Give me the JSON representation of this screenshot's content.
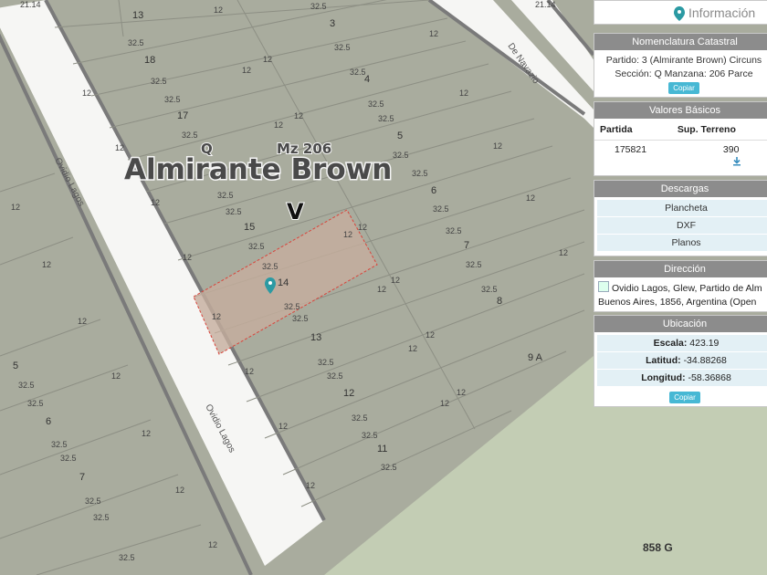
{
  "map": {
    "district_title": "Almirante Brown",
    "manzana_label": "Mz 206",
    "section_label": "Q",
    "circ_label": "V",
    "area_label": "858 G",
    "streets": [
      "Ovidio Lagos",
      "Ovidio Lagos",
      "De Navazio"
    ],
    "lot_numbers": [
      "3",
      "4",
      "5",
      "6",
      "7",
      "8",
      "9 A",
      "18",
      "17",
      "15",
      "14",
      "13",
      "12",
      "11",
      "5",
      "6",
      "7",
      "13"
    ],
    "dimensions": [
      "32.5",
      "12",
      "21.14"
    ],
    "selected_lot": "14"
  },
  "panel": {
    "info_title": "Información",
    "nomenclatura": {
      "header": "Nomenclatura Catastral",
      "line1": "Partido: 3 (Almirante Brown) Circuns",
      "line2": "Sección: Q Manzana: 206 Parce",
      "button": "Copiar"
    },
    "valores": {
      "header": "Valores Básicos",
      "col1": "Partida",
      "col2": "Sup. Terreno",
      "partida": "175821",
      "superficie": "390"
    },
    "descargas": {
      "header": "Descargas",
      "items": [
        "Plancheta",
        "DXF",
        "Planos"
      ]
    },
    "direccion": {
      "header": "Dirección",
      "line1": "Ovidio Lagos, Glew, Partido de Alm",
      "line2": "Buenos Aires, 1856, Argentina (Open"
    },
    "ubicacion": {
      "header": "Ubicación",
      "escala_label": "Escala:",
      "escala": "423.19",
      "latitud_label": "Latitud:",
      "latitud": "-34.88268",
      "longitud_label": "Longitud:",
      "longitud": "-58.36868",
      "button": "Copiar"
    }
  }
}
